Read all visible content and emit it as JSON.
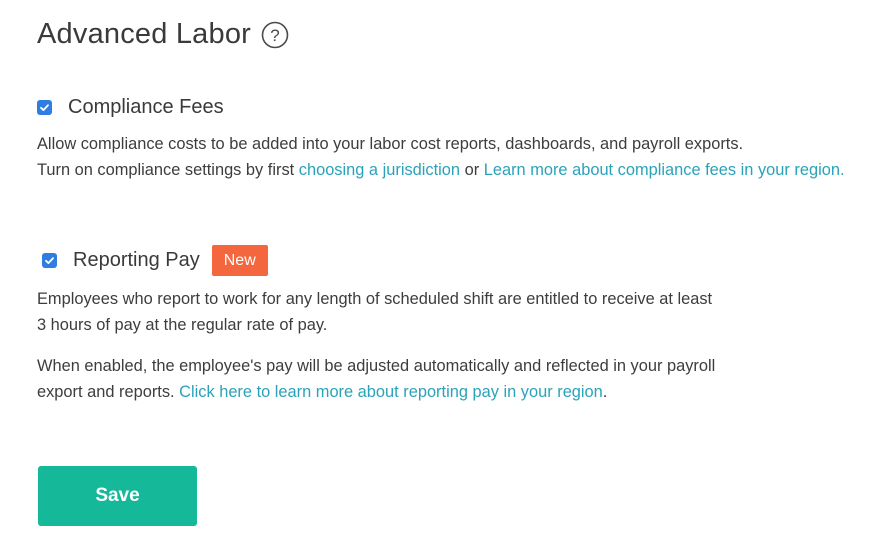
{
  "header": {
    "title": "Advanced Labor",
    "help_icon": "question-circle-icon"
  },
  "compliance_fees": {
    "checked": true,
    "label": "Compliance Fees",
    "desc_line1": "Allow compliance costs to be added into your labor cost reports, dashboards, and payroll exports.",
    "desc_line2_prefix": "Turn on compliance settings by first ",
    "link_jurisdiction": "choosing a jurisdiction",
    "desc_or": " or ",
    "link_learn_more": "Learn more about compliance fees in your region."
  },
  "reporting_pay": {
    "checked": true,
    "label": "Reporting Pay",
    "badge": "New",
    "desc_line1": "Employees who report to work for any length of scheduled shift are entitled to receive at least",
    "desc_line2": "3 hours of pay at the regular rate of pay.",
    "desc2_line1": "When enabled, the employee's pay will be adjusted automatically and reflected in your payroll",
    "desc2_line2_prefix": "export and reports. ",
    "link_learn_more": "Click here to learn more about reporting pay in your region",
    "desc2_suffix": "."
  },
  "actions": {
    "save_label": "Save"
  },
  "colors": {
    "checkbox": "#2f7de1",
    "link": "#2aa3b9",
    "badge": "#f4663e",
    "save_button": "#16b89a"
  }
}
